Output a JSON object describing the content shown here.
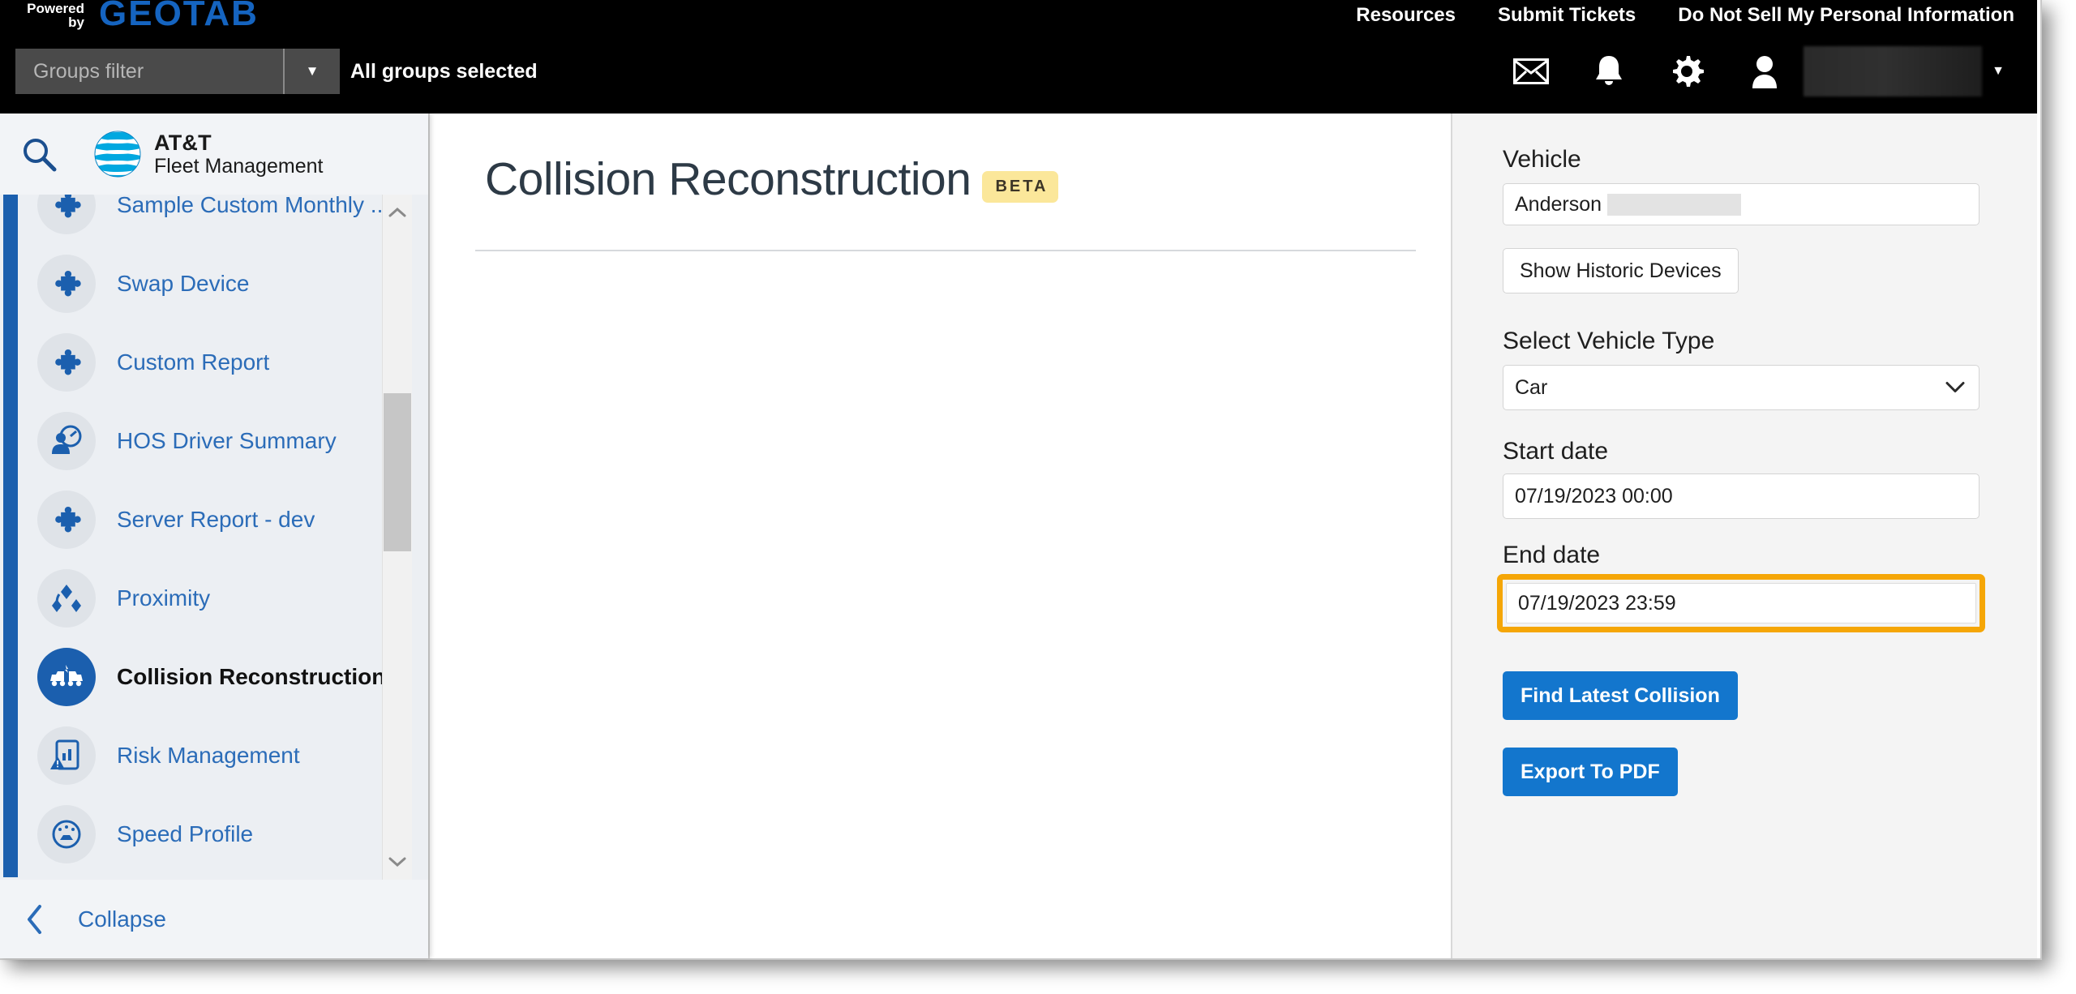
{
  "topbar": {
    "powered_line1": "Powered",
    "powered_line2": "by",
    "brand": "GEOTAB",
    "links": [
      {
        "label": "Resources",
        "name": "resources"
      },
      {
        "label": "Submit Tickets",
        "name": "submit-tickets"
      },
      {
        "label": "Do Not Sell My Personal Information",
        "name": "do-not-sell"
      }
    ],
    "groups_filter_placeholder": "Groups filter",
    "groups_status": "All groups selected",
    "icons": [
      "mail-icon",
      "bell-icon",
      "gear-icon",
      "user-icon"
    ],
    "user_name_redacted": "",
    "accent_blue": "#1564c0"
  },
  "sidebar": {
    "search_icon": "search-icon",
    "brand_line1": "AT&T",
    "brand_line2": "Fleet Management",
    "items": [
      {
        "label": "Sample Custom Monthly ...",
        "icon": "puzzle-icon",
        "active": false
      },
      {
        "label": "Swap Device",
        "icon": "puzzle-icon",
        "active": false
      },
      {
        "label": "Custom Report",
        "icon": "puzzle-icon",
        "active": false
      },
      {
        "label": "HOS Driver Summary",
        "icon": "driver-gauge-icon",
        "active": false
      },
      {
        "label": "Server Report - dev",
        "icon": "puzzle-icon",
        "active": false
      },
      {
        "label": "Proximity",
        "icon": "proximity-icon",
        "active": false
      },
      {
        "label": "Collision Reconstruction",
        "icon": "collision-icon",
        "active": true
      },
      {
        "label": "Risk Management",
        "icon": "risk-document-icon",
        "active": false
      },
      {
        "label": "Speed Profile",
        "icon": "speedometer-icon",
        "active": false
      }
    ],
    "collapse_label": "Collapse",
    "accent_color": "#1b5fae"
  },
  "main": {
    "title": "Collision Reconstruction",
    "badge": "BETA",
    "badge_color": "#fbe79a"
  },
  "panel": {
    "vehicle_label": "Vehicle",
    "vehicle_value": "Anderson",
    "show_historic_label": "Show Historic Devices",
    "vehicle_type_label": "Select Vehicle Type",
    "vehicle_type_value": "Car",
    "vehicle_type_options": [
      "Car"
    ],
    "start_date_label": "Start date",
    "start_date_value": "07/19/2023 00:00",
    "end_date_label": "End date",
    "end_date_value": "07/19/2023 23:59",
    "end_date_highlight_color": "#f5a606",
    "find_button_label": "Find Latest Collision",
    "export_button_label": "Export To PDF",
    "primary_button_color": "#1376cd"
  }
}
